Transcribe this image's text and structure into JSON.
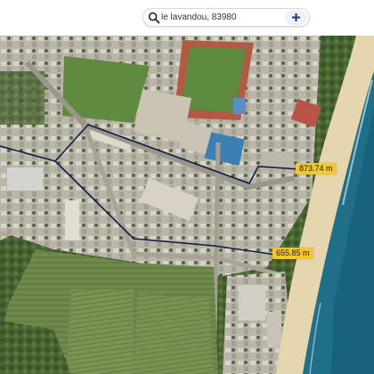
{
  "search": {
    "value": "le lavandou, 83980",
    "search_icon": "search-icon",
    "add_icon": "plus-icon"
  },
  "map": {
    "type": "satellite",
    "route_color": "#0d1b45",
    "label_color": "#f3c632"
  },
  "measurements": [
    {
      "label": "873.74 m"
    },
    {
      "label": "655.85 m"
    }
  ]
}
